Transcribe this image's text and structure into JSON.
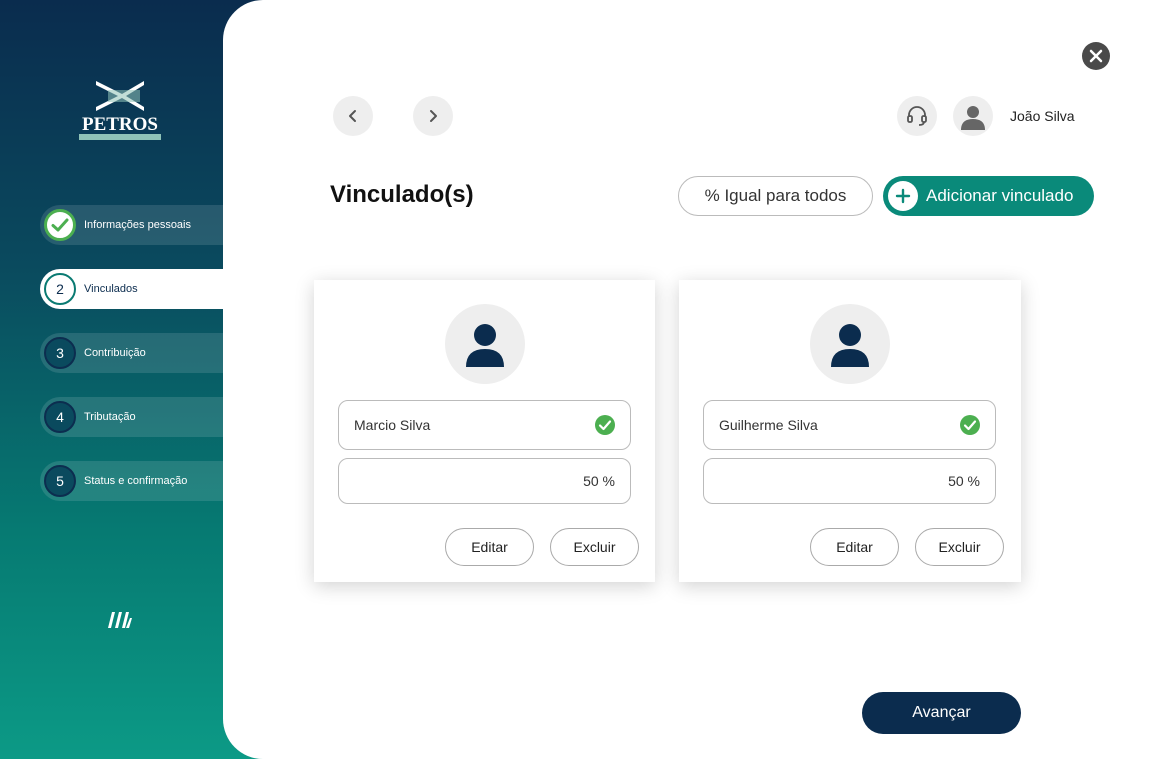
{
  "brand": {
    "name": "PETROS"
  },
  "steps": [
    {
      "number": "",
      "label": "Informações pessoais",
      "state": "done"
    },
    {
      "number": "2",
      "label": "Vinculados",
      "state": "active"
    },
    {
      "number": "3",
      "label": "Contribuição",
      "state": "pending"
    },
    {
      "number": "4",
      "label": "Tributação",
      "state": "pending"
    },
    {
      "number": "5",
      "label": "Status e confirmação",
      "state": "pending"
    }
  ],
  "header": {
    "user_name": "João Silva",
    "icons": [
      "chevron-left-icon",
      "chevron-right-icon",
      "headset-icon",
      "user-icon",
      "close-icon"
    ]
  },
  "main": {
    "title": "Vinculado(s)",
    "equal_label": "% Igual para todos",
    "add_label": "Adicionar vinculado"
  },
  "linked": [
    {
      "name": "Marcio Silva",
      "percent": "50 %",
      "edit_label": "Editar",
      "delete_label": "Excluir",
      "verified": true
    },
    {
      "name": "Guilherme Silva",
      "percent": "50 %",
      "edit_label": "Editar",
      "delete_label": "Excluir",
      "verified": true
    }
  ],
  "footer": {
    "next_label": "Avançar"
  },
  "colors": {
    "navy": "#0b2c4e",
    "teal": "#0a8a7a",
    "success": "#4caf50"
  }
}
